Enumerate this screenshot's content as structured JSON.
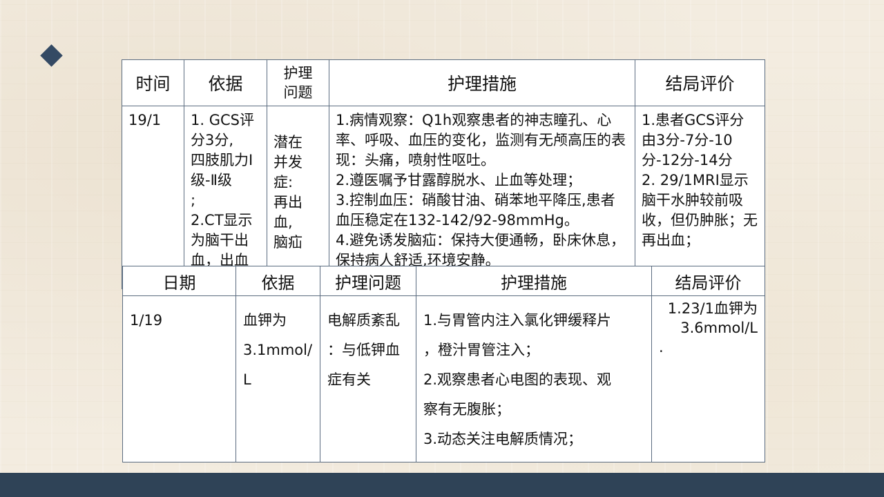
{
  "table1": {
    "headers": [
      "时间",
      "依据",
      "护理\n问题",
      "护理措施",
      "结局评价"
    ],
    "header_problem_line1": "护理",
    "header_problem_line2": "问题",
    "row": {
      "time": "19/1",
      "basis": [
        "1. GCS评分3分,",
        "四肢肌力Ⅰ级-Ⅱ级",
        ";",
        " 2.CT显示为脑干出血，出血"
      ],
      "problem": [
        "潜在",
        "并发",
        "症:",
        "再出",
        "血,",
        "脑疝"
      ],
      "measures": [
        "1.病情观察：Q1h观察患者的神志瞳孔、心率、呼吸、血压的变化，监测有无颅高压的表现：头痛，喷射性呕吐。",
        "2.遵医嘱予甘露醇脱水、止血等处理；",
        "3.控制血压：硝酸甘油、硝苯地平降压,患者血压稳定在132-142/92-98mmHg。",
        "4.避免诱发脑疝：保持大便通畅，卧床休息，保持病人舒适,环境安静。"
      ],
      "evaluation": [
        "1.患者GCS评分由3分-7分-10分-12分-14分",
        "2. 29/1MRI显示脑干水肿较前吸收，但仍肿胀；无再出血；"
      ]
    }
  },
  "table2": {
    "headers": [
      "日期",
      "依据",
      "护理问题",
      "护理措施",
      "结局评价"
    ],
    "row": {
      "date": "1/19",
      "basis": [
        "血钾为",
        "3.1mmol/",
        "L"
      ],
      "problem": [
        "电解质紊乱",
        "：与低钾血",
        "症有关"
      ],
      "measures": [
        "1.与胃管内注入氯化钾缓释片",
        "，橙汁胃管注入；",
        "2.观察患者心电图的表现、观",
        "察有无腹胀；",
        "3.动态关注电解质情况；"
      ],
      "evaluation": [
        "1.23/1血钾为",
        "3.6mmol/L",
        "."
      ]
    }
  }
}
